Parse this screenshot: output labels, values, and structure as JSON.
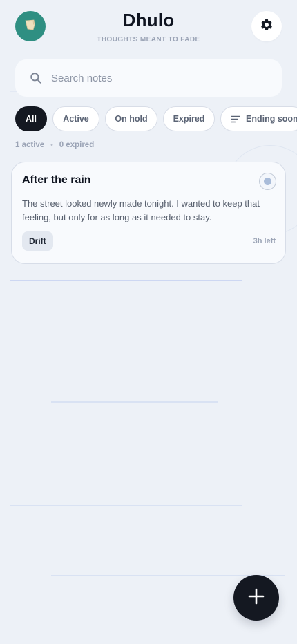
{
  "header": {
    "title": "Dhulo",
    "subtitle": "THOUGHTS MEANT TO FADE",
    "avatar_icon": "paper-scrap-icon",
    "settings_icon": "gear-icon"
  },
  "search": {
    "placeholder": "Search notes",
    "value": "",
    "icon": "search-icon"
  },
  "filters": [
    {
      "label": "All",
      "selected": true
    },
    {
      "label": "Active",
      "selected": false
    },
    {
      "label": "On hold",
      "selected": false
    },
    {
      "label": "Expired",
      "selected": false
    }
  ],
  "sort": {
    "label": "Ending soon",
    "icon": "sort-lines-icon"
  },
  "counts": {
    "active": "1 active",
    "separator": "•",
    "expired": "0 expired"
  },
  "notes": [
    {
      "title": "After the rain",
      "body": "The street looked newly made tonight. I wanted to keep that feeling, but only for as long as it needed to stay.",
      "tag": "Drift",
      "time_left": "3h left",
      "status_icon": "status-dot-icon"
    }
  ],
  "fab": {
    "icon": "plus-icon"
  },
  "colors": {
    "background": "#edf1f7",
    "accent": "#141821",
    "avatar": "#2f8f82",
    "muted_text": "#9aa3b5"
  }
}
